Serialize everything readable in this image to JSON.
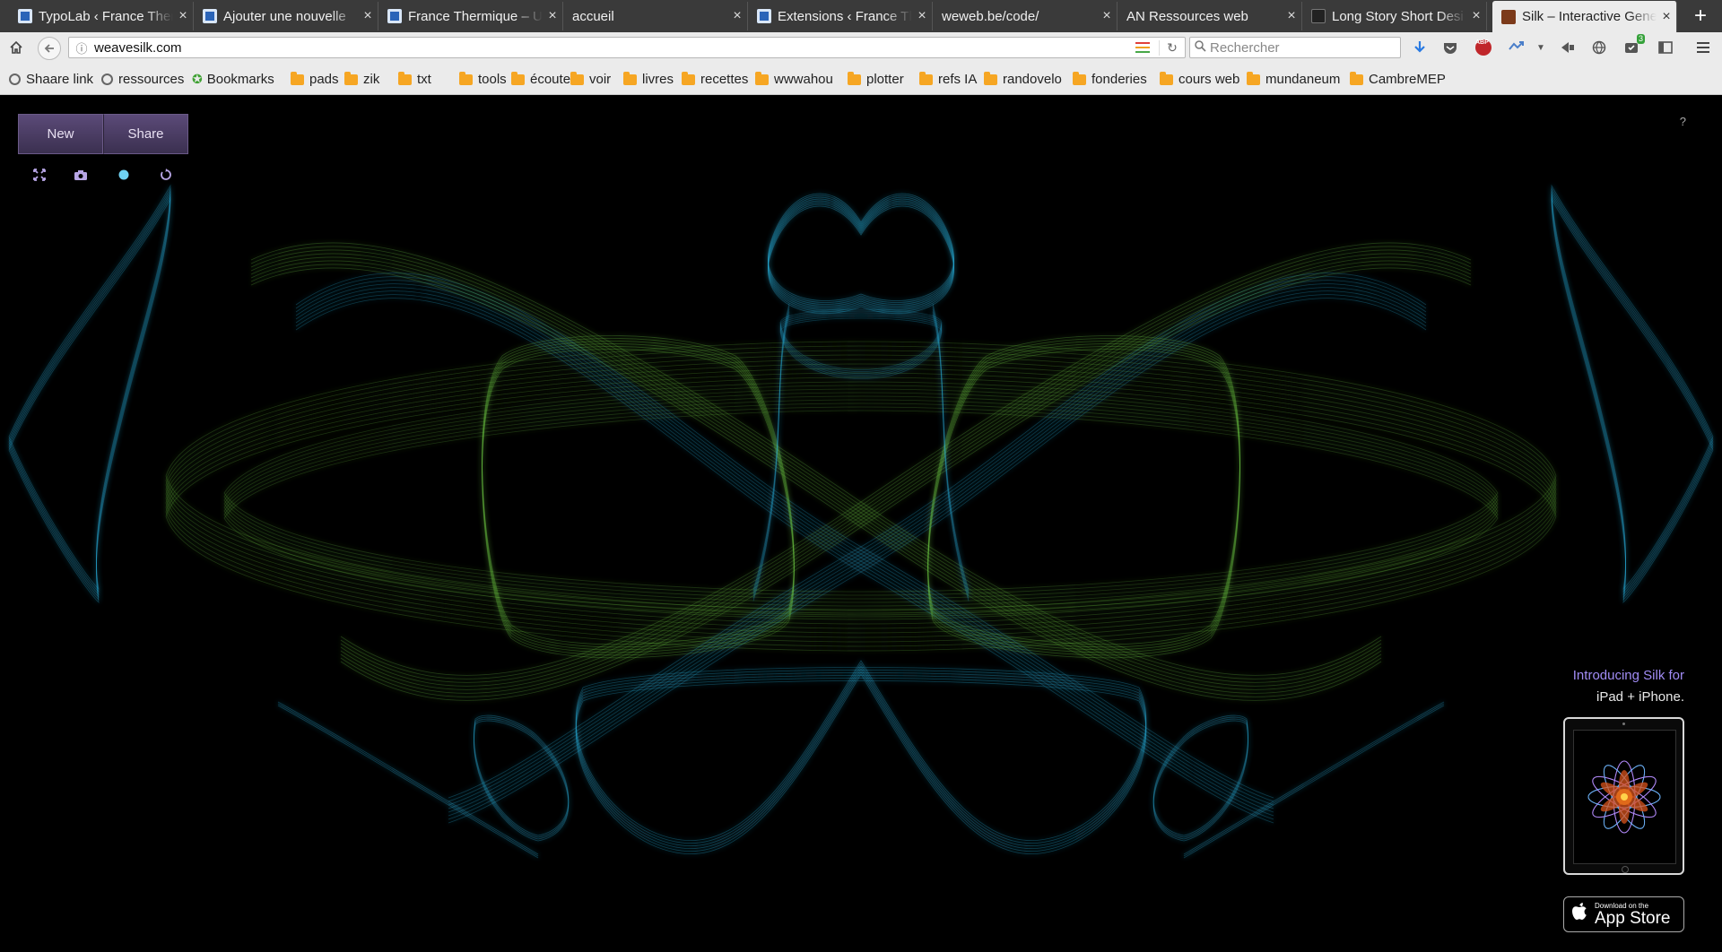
{
  "tabs": [
    {
      "title": "TypoLab ‹ France Ther",
      "favicon": "wordpress-icon"
    },
    {
      "title": "Ajouter une nouvelle",
      "favicon": "wordpress-icon"
    },
    {
      "title": "France Thermique – U",
      "favicon": "wordpress-icon"
    },
    {
      "title": "accueil",
      "favicon": "none"
    },
    {
      "title": "Extensions ‹ France Th",
      "favicon": "wordpress-icon"
    },
    {
      "title": "weweb.be/code/",
      "favicon": "none"
    },
    {
      "title": "AN Ressources web",
      "favicon": "none"
    },
    {
      "title": "Long Story Short Desi",
      "favicon": "lss-icon"
    },
    {
      "title": "Silk – Interactive Gene",
      "favicon": "silk-icon",
      "active": true
    }
  ],
  "close_glyph": "×",
  "new_tab_glyph": "+",
  "address": {
    "url": "weavesilk.com"
  },
  "search": {
    "placeholder": "Rechercher"
  },
  "toolbar": {
    "downloads_badge": "3"
  },
  "bookmarks": [
    {
      "label": "Shaare link",
      "type": "globe"
    },
    {
      "label": "ressources",
      "type": "globe"
    },
    {
      "label": "Bookmarks",
      "type": "star"
    },
    {
      "label": "pads",
      "type": "folder"
    },
    {
      "label": "zik",
      "type": "folder"
    },
    {
      "label": "txt",
      "type": "folder"
    },
    {
      "label": "tools",
      "type": "folder"
    },
    {
      "label": "écouter",
      "type": "folder"
    },
    {
      "label": "voir",
      "type": "folder"
    },
    {
      "label": "livres",
      "type": "folder"
    },
    {
      "label": "recettes",
      "type": "folder"
    },
    {
      "label": "wwwahou",
      "type": "folder"
    },
    {
      "label": "plotter",
      "type": "folder"
    },
    {
      "label": "refs IA",
      "type": "folder"
    },
    {
      "label": "randovelo",
      "type": "folder"
    },
    {
      "label": "fonderies",
      "type": "folder"
    },
    {
      "label": "cours web",
      "type": "folder"
    },
    {
      "label": "mundaneum",
      "type": "folder"
    },
    {
      "label": "CambreMEP",
      "type": "folder"
    }
  ],
  "silk": {
    "new_label": "New",
    "share_label": "Share",
    "help_label": "?",
    "promo_line1": "Introducing Silk for",
    "promo_line2": "iPad + iPhone.",
    "appstore_small": "Download on the",
    "appstore_big": "App Store",
    "icons": [
      "fullscreen-icon",
      "camera-icon",
      "color-dot-icon",
      "undo-icon"
    ],
    "colors": {
      "green": "#7be04a",
      "cyan": "#2bb6e6",
      "accent": "#a18cf5"
    }
  }
}
